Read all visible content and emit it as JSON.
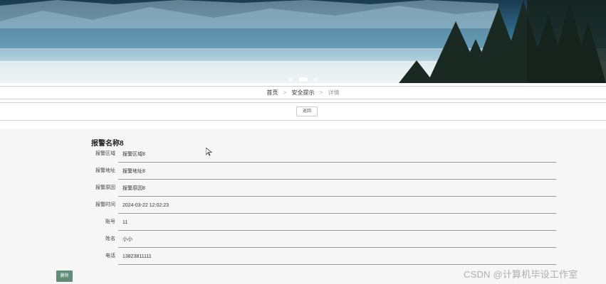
{
  "banner": {
    "dots": [
      false,
      true,
      false
    ]
  },
  "breadcrumb": {
    "home": "首页",
    "section": "安全提示",
    "current": "详情"
  },
  "back_button": {
    "label": "返回"
  },
  "detail": {
    "title": "报警名称8",
    "fields": [
      {
        "label": "报警区域",
        "value": "报警区域8"
      },
      {
        "label": "报警地址",
        "value": "报警地址8"
      },
      {
        "label": "报警原因",
        "value": "报警原因8"
      },
      {
        "label": "报警时间",
        "value": "2024-03-22 12:02:23"
      },
      {
        "label": "账号",
        "value": "11"
      },
      {
        "label": "姓名",
        "value": "小小"
      },
      {
        "label": "电话",
        "value": "13823811111"
      }
    ]
  },
  "delete_button": {
    "label": "删除"
  },
  "watermark": "CSDN @计算机毕设工作室",
  "colors": {
    "delete_button": "#5f8d78",
    "detail_background": "#f6f6f6"
  }
}
